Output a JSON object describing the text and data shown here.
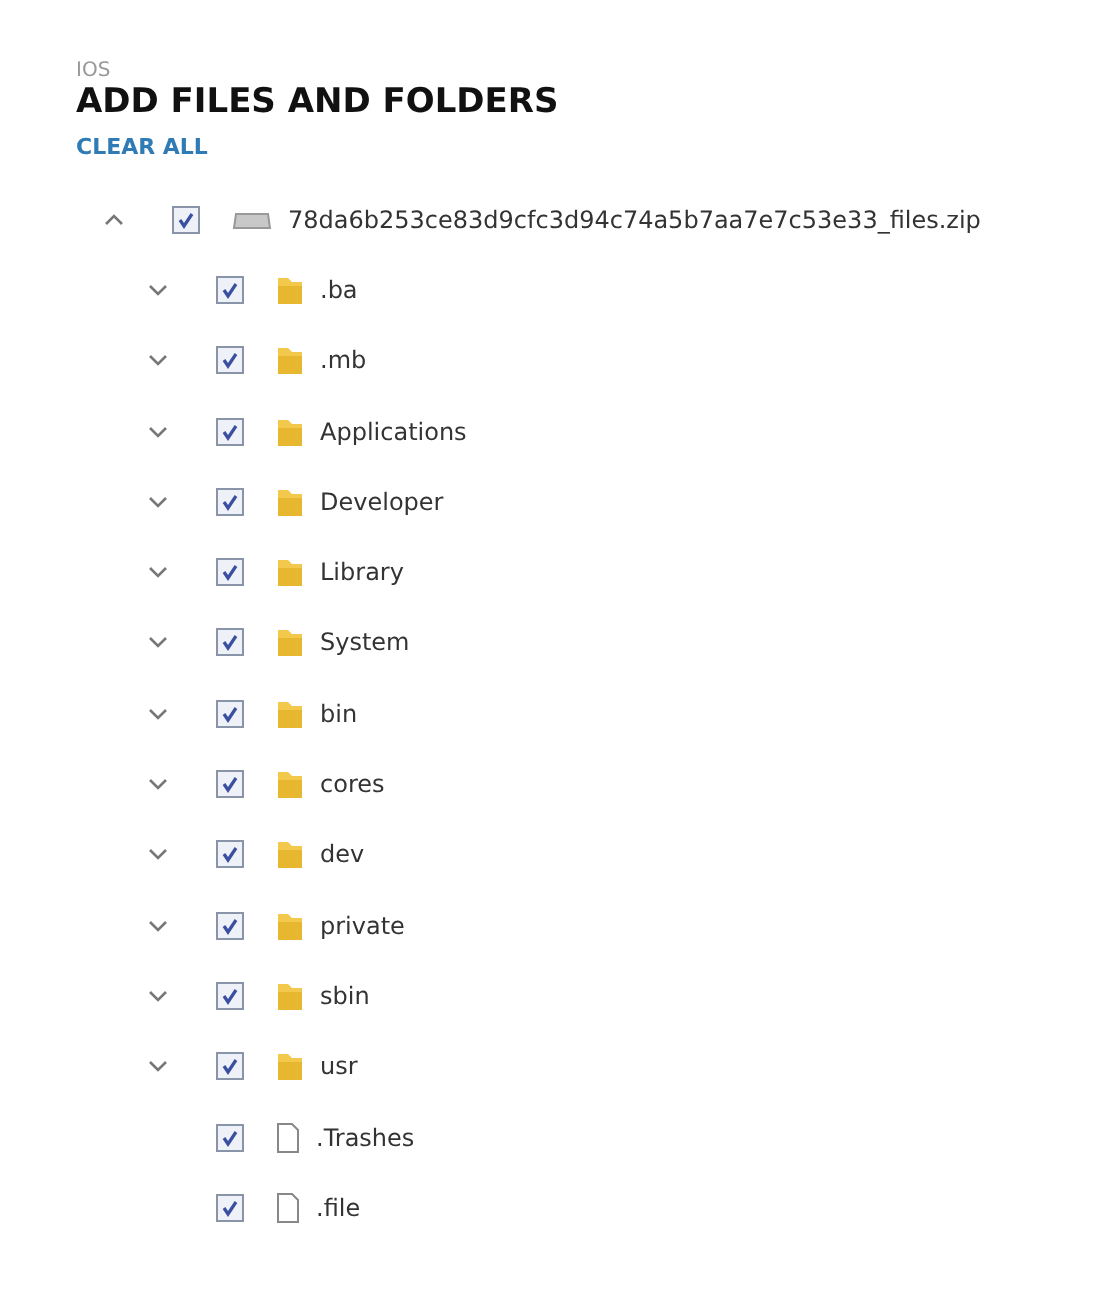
{
  "section": "IOS",
  "title": "ADD FILES AND FOLDERS",
  "clear_all": "CLEAR ALL",
  "tree": [
    {
      "name": "78da6b253ce83d9cfc3d94c74a5b7aa7e7c53e33_files.zip",
      "kind": "archive",
      "expanded": true,
      "checked": true,
      "children": [
        {
          "name": ".ba",
          "kind": "folder",
          "expanded": false,
          "checked": true
        },
        {
          "name": ".mb",
          "kind": "folder",
          "expanded": false,
          "checked": true
        },
        {
          "name": "Applications",
          "kind": "folder",
          "expanded": false,
          "checked": true
        },
        {
          "name": "Developer",
          "kind": "folder",
          "expanded": false,
          "checked": true
        },
        {
          "name": "Library",
          "kind": "folder",
          "expanded": false,
          "checked": true
        },
        {
          "name": "System",
          "kind": "folder",
          "expanded": false,
          "checked": true
        },
        {
          "name": "bin",
          "kind": "folder",
          "expanded": false,
          "checked": true
        },
        {
          "name": "cores",
          "kind": "folder",
          "expanded": false,
          "checked": true
        },
        {
          "name": "dev",
          "kind": "folder",
          "expanded": false,
          "checked": true
        },
        {
          "name": "private",
          "kind": "folder",
          "expanded": false,
          "checked": true
        },
        {
          "name": "sbin",
          "kind": "folder",
          "expanded": false,
          "checked": true
        },
        {
          "name": "usr",
          "kind": "folder",
          "expanded": false,
          "checked": true
        },
        {
          "name": ".Trashes",
          "kind": "file",
          "checked": true
        },
        {
          "name": ".file",
          "kind": "file",
          "checked": true
        }
      ]
    }
  ]
}
